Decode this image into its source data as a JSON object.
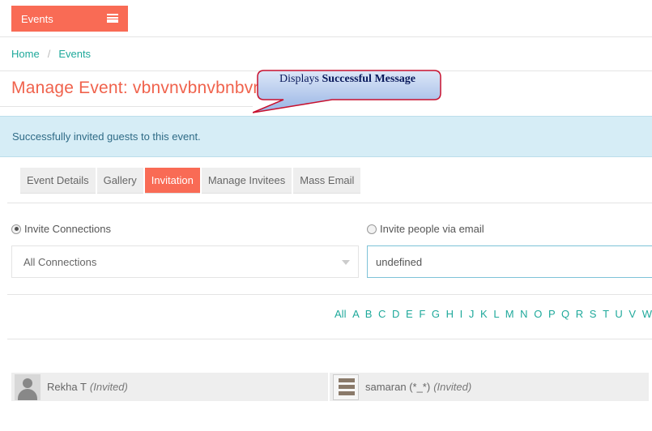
{
  "header": {
    "menu_label": "Events"
  },
  "breadcrumb": {
    "home": "Home",
    "separator": "/",
    "current": "Events"
  },
  "page": {
    "title": "Manage Event: vbnvnvbnvbnbvn"
  },
  "callout": {
    "prefix": "Displays",
    "emphasis": "Successful  Message"
  },
  "alert": {
    "message": "Successfully invited guests to this event."
  },
  "tabs": [
    {
      "label": "Event Details",
      "active": false
    },
    {
      "label": "Gallery",
      "active": false
    },
    {
      "label": "Invitation",
      "active": true
    },
    {
      "label": "Manage Invitees",
      "active": false
    },
    {
      "label": "Mass Email",
      "active": false
    }
  ],
  "invite": {
    "connections_label": "Invite Connections",
    "email_label": "Invite people via email",
    "select_value": "All Connections",
    "email_value": "undefined"
  },
  "alphabet": [
    "All",
    "A",
    "B",
    "C",
    "D",
    "E",
    "F",
    "G",
    "H",
    "I",
    "J",
    "K",
    "L",
    "M",
    "N",
    "O",
    "P",
    "Q",
    "R",
    "S",
    "T",
    "U",
    "V",
    "W"
  ],
  "guests": [
    {
      "name": "Rekha T",
      "status": "(Invited)",
      "avatar": "person-icon"
    },
    {
      "name": "samaran (*_*)",
      "status": "(Invited)",
      "avatar": "group-photo-icon"
    }
  ],
  "colors": {
    "accent": "#f96b55",
    "link": "#1fa99b",
    "alert_bg": "#d6edf6",
    "callout_fill": "#b6ccef",
    "callout_border": "#c8102e"
  }
}
